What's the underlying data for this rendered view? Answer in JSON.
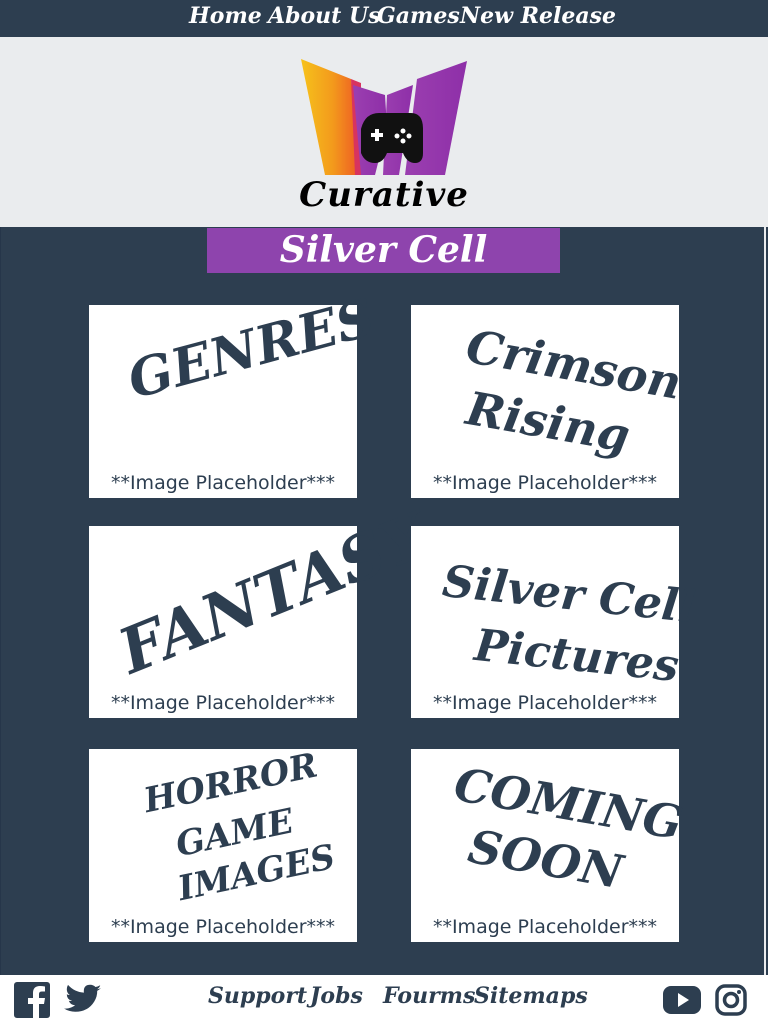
{
  "nav": {
    "items": [
      "Home",
      "About Us",
      "Games",
      "New Release"
    ]
  },
  "header": {
    "brand": "Curative"
  },
  "banner": {
    "title": "Silver Cell"
  },
  "cards": [
    {
      "title": "GENRES",
      "caption": "**Image Placeholder***"
    },
    {
      "title_line1": "Crimson",
      "title_line2": "Rising",
      "caption": "**Image Placeholder***"
    },
    {
      "title": "FANTASY",
      "caption": "**Image Placeholder***"
    },
    {
      "title_line1": "Silver Cell",
      "title_line2": "Pictures",
      "caption": "**Image Placeholder***"
    },
    {
      "title_line1": "HORROR",
      "title_line2": "GAME",
      "title_line3": "IMAGES",
      "caption": "**Image Placeholder***"
    },
    {
      "title_line1": "COMING",
      "title_line2": "SOON",
      "caption": "**Image Placeholder***"
    }
  ],
  "footer": {
    "links": [
      "Support",
      "Jobs",
      "Fourms",
      "Sitemaps"
    ],
    "icons": [
      "facebook-icon",
      "twitter-icon",
      "youtube-icon",
      "instagram-icon"
    ]
  },
  "colors": {
    "navy": "#2d3e50",
    "purple": "#8e44ad",
    "header_bg": "#eaecee",
    "white": "#ffffff"
  }
}
